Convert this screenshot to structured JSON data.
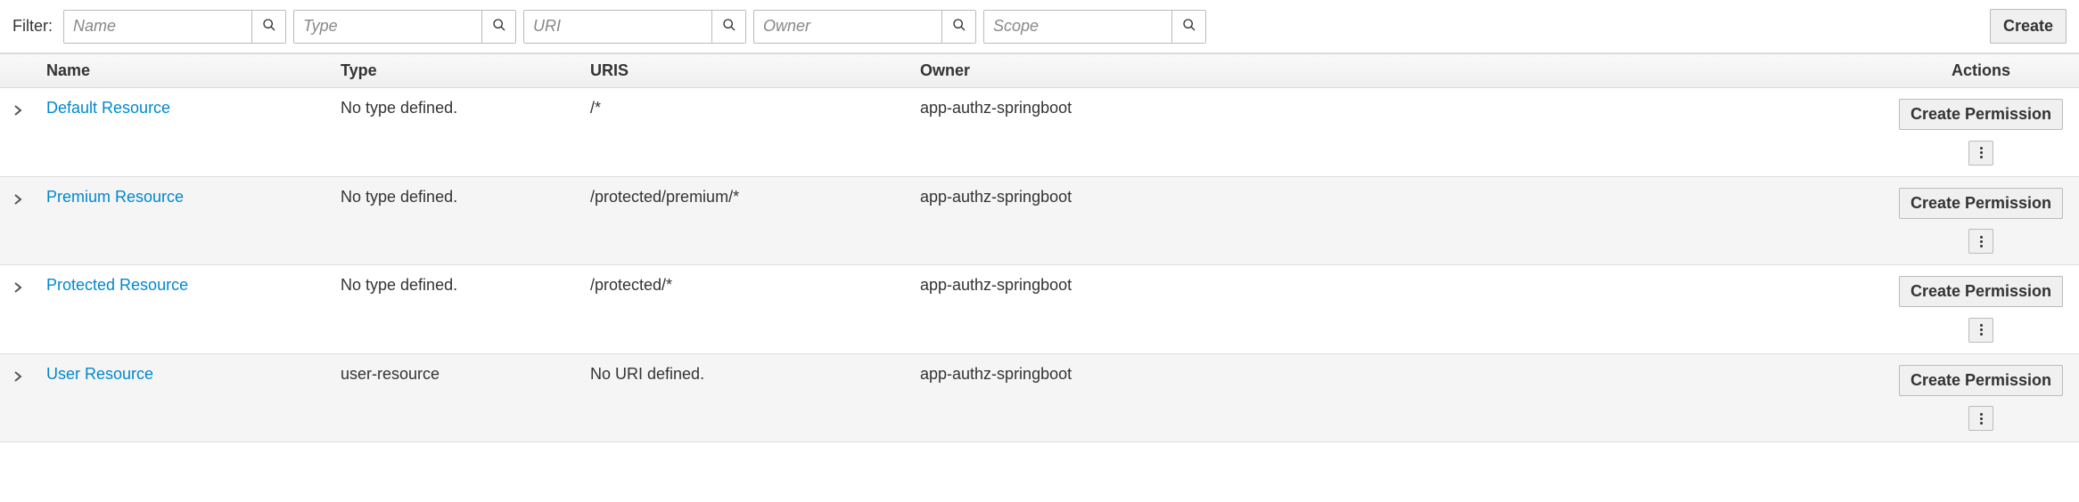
{
  "filter": {
    "label": "Filter:",
    "fields": [
      {
        "name": "name",
        "placeholder": "Name"
      },
      {
        "name": "type",
        "placeholder": "Type"
      },
      {
        "name": "uri",
        "placeholder": "URI"
      },
      {
        "name": "owner",
        "placeholder": "Owner"
      },
      {
        "name": "scope",
        "placeholder": "Scope"
      }
    ]
  },
  "buttons": {
    "create": "Create",
    "create_permission": "Create Permission"
  },
  "table": {
    "headers": {
      "name": "Name",
      "type": "Type",
      "uris": "URIS",
      "owner": "Owner",
      "actions": "Actions"
    },
    "rows": [
      {
        "name": "Default Resource",
        "type": "No type defined.",
        "uris": "/*",
        "owner": "app-authz-springboot"
      },
      {
        "name": "Premium Resource",
        "type": "No type defined.",
        "uris": "/protected/premium/*",
        "owner": "app-authz-springboot"
      },
      {
        "name": "Protected Resource",
        "type": "No type defined.",
        "uris": "/protected/*",
        "owner": "app-authz-springboot"
      },
      {
        "name": "User Resource",
        "type": "user-resource",
        "uris": "No URI defined.",
        "owner": "app-authz-springboot"
      }
    ]
  }
}
